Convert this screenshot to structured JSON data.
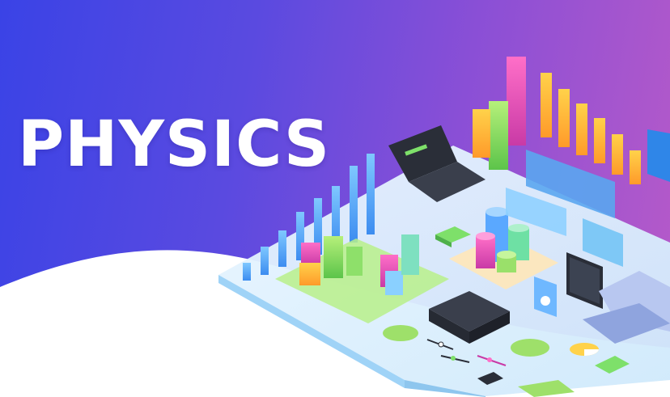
{
  "banner": {
    "title": "PHYSICS"
  },
  "colors": {
    "gradient_start": "#3a43e6",
    "gradient_end": "#b85ac8",
    "title_text": "#ffffff",
    "wave": "#ffffff"
  },
  "illustration": {
    "style": "isometric data-visualization scene",
    "icons": [
      "bar-chart-icon",
      "laptop-icon",
      "tablet-icon",
      "phone-icon",
      "cylinder-chart-icon",
      "cube-chart-icon",
      "pie-chart-icon",
      "slider-icon",
      "toggle-icon"
    ]
  }
}
